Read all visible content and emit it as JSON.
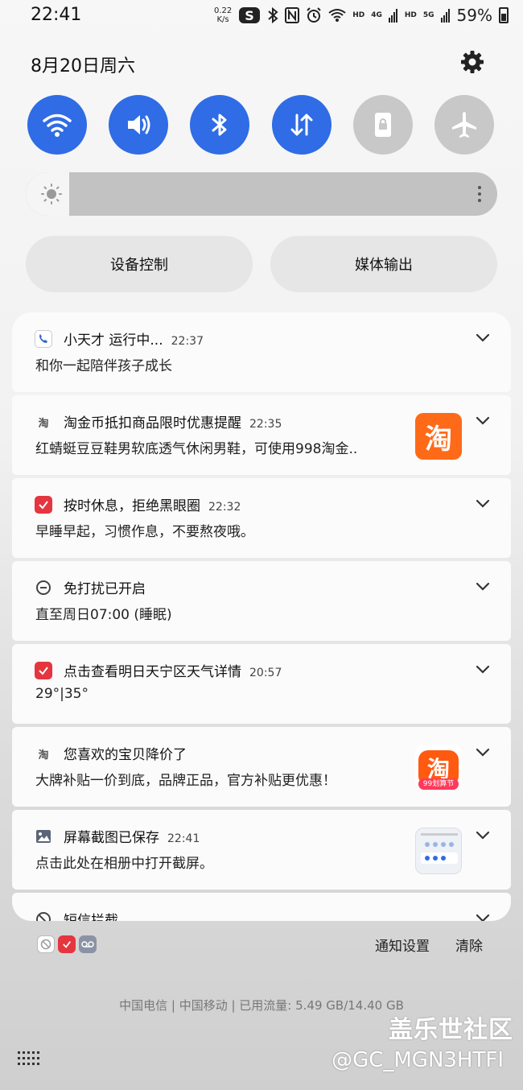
{
  "status_bar": {
    "time": "22:41",
    "net_speed_value": "0.22",
    "net_speed_unit": "K/s",
    "hd1": "HD",
    "sig1": "4G",
    "hd2": "HD",
    "sig2": "5G",
    "battery": "59%"
  },
  "header": {
    "date": "8月20日周六"
  },
  "quick_toggles": [
    {
      "name": "wifi",
      "state": "on"
    },
    {
      "name": "sound",
      "state": "on"
    },
    {
      "name": "bluetooth",
      "state": "on"
    },
    {
      "name": "mobile-data",
      "state": "on"
    },
    {
      "name": "rotation-lock",
      "state": "off"
    },
    {
      "name": "airplane-mode",
      "state": "off"
    }
  ],
  "brightness": {
    "level": 0.08
  },
  "buttons": {
    "device_control": "设备控制",
    "media_output": "媒体输出"
  },
  "notifications": [
    {
      "icon": "xiaotiancai-icon",
      "title": "小天才 运行中...",
      "time": "22:37",
      "body": "和你一起陪伴孩子成长"
    },
    {
      "icon": "taobao-icon",
      "title": "淘金币抵扣商品限时优惠提醒",
      "time": "22:35",
      "body": "红蜻蜓豆豆鞋男软底透气休闲男鞋，可使用998淘金..",
      "thumb": "淘"
    },
    {
      "icon": "health-icon",
      "title": "按时休息，拒绝黑眼圈",
      "time": "22:32",
      "body": "早睡早起，习惯作息，不要熬夜哦。"
    },
    {
      "icon": "dnd-icon",
      "title": "免打扰已开启",
      "time": "",
      "body": "直至周日07:00 (睡眠)"
    },
    {
      "icon": "health-icon",
      "title": "点击查看明日天宁区天气详情",
      "time": "20:57",
      "body": "29°|35°"
    },
    {
      "icon": "taobao-icon",
      "title": "您喜欢的宝贝降价了",
      "time": "",
      "body": "大牌补贴一价到底，品牌正品，官方补贴更优惠！",
      "thumb": "淘",
      "thumb_badge": "99划算节"
    },
    {
      "icon": "gallery-icon",
      "title": "屏幕截图已保存",
      "time": "22:41",
      "body": "点击此处在相册中打开截屏。"
    },
    {
      "icon": "sms-block-icon",
      "title": "短信拦截",
      "time": "",
      "body": ""
    }
  ],
  "footer": {
    "notification_settings": "通知设置",
    "clear": "清除",
    "carrier_info": "中国电信 | 中国移动 | 已用流量: 5.49 GB/14.40 GB"
  },
  "watermark": {
    "brand": "盖乐世社区",
    "handle": "@GC_MGN3HTFI"
  },
  "colors": {
    "toggle_on": "#2f6ce5",
    "toggle_off": "#c8c8c8",
    "taobao": "#ff6a18",
    "health": "#e5353f"
  }
}
